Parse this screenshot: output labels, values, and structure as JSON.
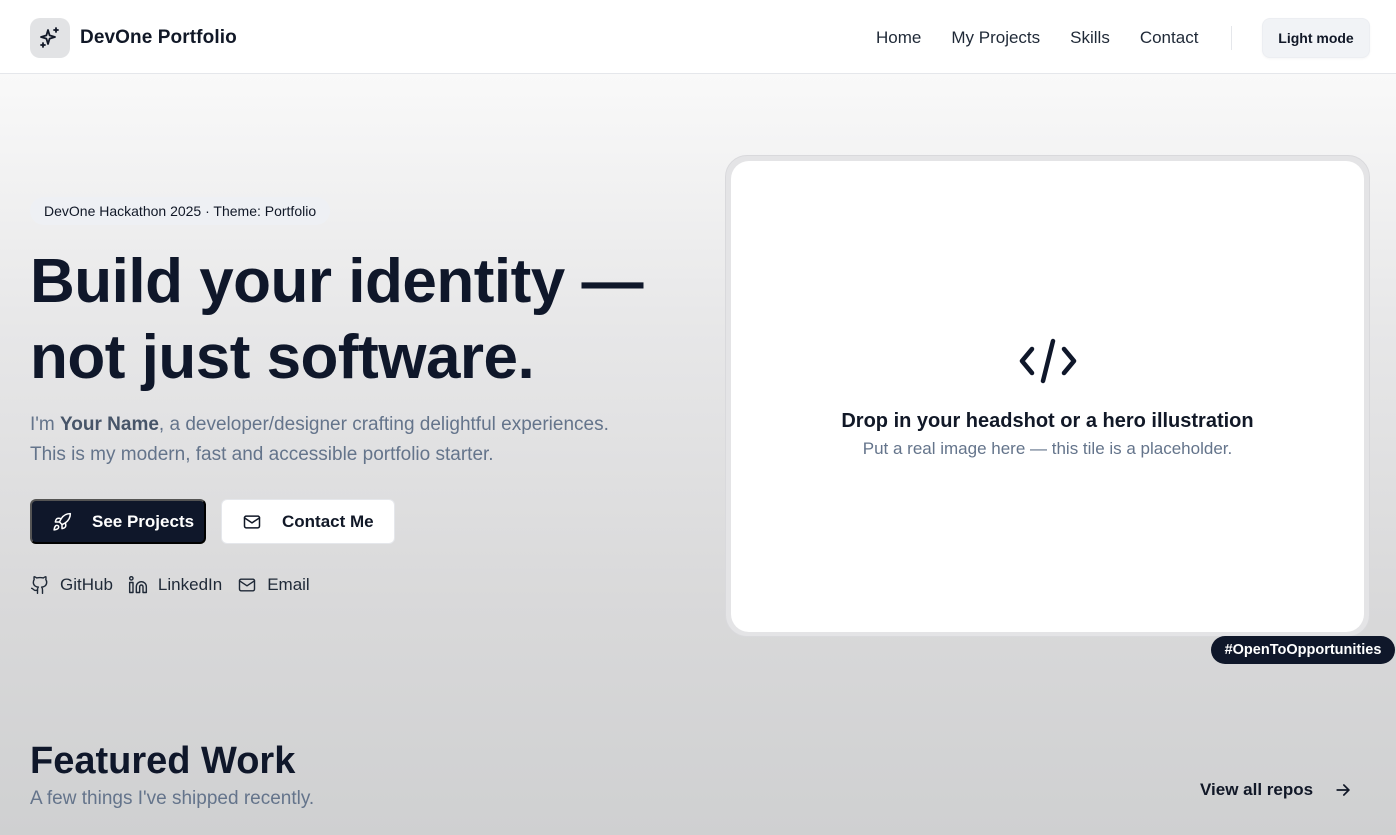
{
  "header": {
    "brand_name": "DevOne Portfolio",
    "nav": [
      "Home",
      "My Projects",
      "Skills",
      "Contact"
    ],
    "mode_label": "Light mode"
  },
  "hero": {
    "badge": "DevOne Hackathon 2025 · Theme: Portfolio",
    "headline_line1": "Build your identity —",
    "headline_line2": "not just software.",
    "intro_prefix": "I'm ",
    "intro_name": "Your Name",
    "intro_rest": ", a developer/designer crafting delightful experiences.",
    "intro_line2": "This is my modern, fast and accessible portfolio starter.",
    "primary_button": "See Projects",
    "secondary_button": "Contact Me",
    "socials": [
      "GitHub",
      "LinkedIn",
      "Email"
    ]
  },
  "tile": {
    "title": "Drop in your headshot or a hero illustration",
    "subtitle": "Put a real image here — this tile is a placeholder.",
    "tag": "#OpenToOpportunities"
  },
  "featured": {
    "title": "Featured Work",
    "subtitle": "A few things I've shipped recently.",
    "view_all": "View all repos"
  },
  "icons": {
    "brand": "sparkles-icon",
    "primary_button": "rocket-icon",
    "secondary_button": "mail-icon",
    "github": "github-icon",
    "linkedin": "linkedin-icon",
    "email": "mail-icon",
    "tile": "code-icon",
    "view_all": "arrow-right-icon"
  },
  "colors": {
    "primary": "#0f172a",
    "muted_text": "#64748b",
    "badge_bg": "#eef0f4"
  }
}
